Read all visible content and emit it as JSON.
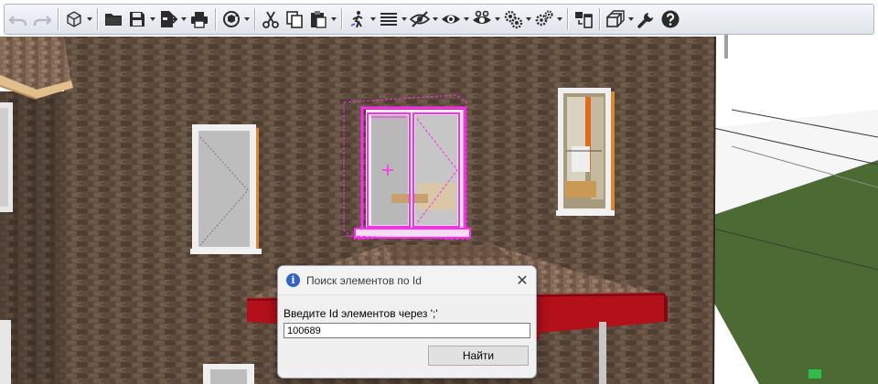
{
  "toolbar": {
    "buttons": [
      {
        "name": "undo-button",
        "icon": "undo-icon",
        "enabled": false
      },
      {
        "name": "redo-button",
        "icon": "redo-icon",
        "enabled": false
      },
      {
        "name": "new-project-button",
        "icon": "cube-icon",
        "enabled": true,
        "dropdown": true
      },
      {
        "name": "open-button",
        "icon": "folder-icon",
        "enabled": true
      },
      {
        "name": "save-button",
        "icon": "save-icon",
        "enabled": true,
        "dropdown": true
      },
      {
        "name": "export-button",
        "icon": "export-icon",
        "enabled": true,
        "dropdown": true
      },
      {
        "name": "print-button",
        "icon": "printer-icon",
        "enabled": true
      },
      {
        "name": "rotate-view-button",
        "icon": "orbit-icon",
        "enabled": true,
        "dropdown": true
      },
      {
        "name": "cut-button",
        "icon": "scissors-icon",
        "enabled": true
      },
      {
        "name": "copy-button",
        "icon": "copy-icon",
        "enabled": true
      },
      {
        "name": "paste-button",
        "icon": "paste-icon",
        "enabled": true,
        "dropdown": true
      },
      {
        "name": "walk-button",
        "icon": "walking-man-icon",
        "enabled": true,
        "dropdown": true
      },
      {
        "name": "list-button",
        "icon": "list-icon",
        "enabled": true,
        "dropdown": true
      },
      {
        "name": "hide-button",
        "icon": "eye-slash-icon",
        "enabled": true,
        "dropdown": true
      },
      {
        "name": "show-button",
        "icon": "eye-icon",
        "enabled": true,
        "dropdown": true
      },
      {
        "name": "visibility-settings-button",
        "icon": "eye-gear-icon",
        "enabled": true,
        "dropdown": true
      },
      {
        "name": "layers-settings-button",
        "icon": "layers-gear-icon",
        "enabled": true,
        "dropdown": true
      },
      {
        "name": "settings-button",
        "icon": "gears-icon",
        "enabled": true,
        "dropdown": true
      },
      {
        "name": "window-layout-button",
        "icon": "windows-icon",
        "enabled": true
      },
      {
        "name": "3d-view-button",
        "icon": "boxes-icon",
        "enabled": true,
        "dropdown": true
      },
      {
        "name": "tools-button",
        "icon": "wrench-icon",
        "enabled": true
      },
      {
        "name": "help-button",
        "icon": "help-icon",
        "enabled": true
      }
    ]
  },
  "dialog": {
    "title": "Поиск элементов по Id",
    "close": "✕",
    "info_glyph": "i",
    "prompt": "Введите Id элементов через ';'",
    "id_value": "100689",
    "find_button": "Найти"
  },
  "colors": {
    "brick": "#5e4b3d",
    "roof_tiles": "#806452",
    "selection": "#ff2cf0",
    "canopy_fascia": "#b3101a",
    "grass": "#4c6b33"
  }
}
